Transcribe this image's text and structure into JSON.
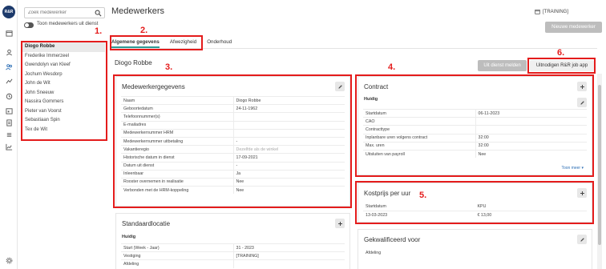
{
  "brand": {
    "logo_text": "R&R"
  },
  "rail_icons": [
    "calendar-icon",
    "user-icon",
    "team-icon",
    "trend-icon",
    "clock-icon",
    "schedule-icon",
    "report-icon",
    "list-icon",
    "chart-icon",
    "settings-icon"
  ],
  "search": {
    "placeholder": "Zoek medewerker"
  },
  "toggle": {
    "label": "Toon medewerkers uit dienst"
  },
  "employees": [
    "Diogo Robbe",
    "Frederike Immerzeel",
    "Gwendolyn van Kleef",
    "Jochum Wesdorp",
    "John de Wit",
    "John Sneeuw",
    "Nassira Gommers",
    "Pieter van Voorst",
    "Sebastiaan Spin",
    "Tex de Wit"
  ],
  "page": {
    "title": "Medewerkers",
    "training": "[TRAINING]",
    "new_button": "Nieuwe medewerker"
  },
  "tabs": [
    "Algemene gegevens",
    "Afwezigheid",
    "Onderhoud"
  ],
  "employee_name": "Diogo Robbe",
  "actions": {
    "out_of_service": "Uit dienst melden",
    "invite_app": "Uitnodigen R&R job app"
  },
  "details": {
    "title": "Medewerkergegevens",
    "rows": [
      {
        "k": "Naam",
        "v": "Diogo Robbe"
      },
      {
        "k": "Geboortedatum",
        "v": "24-11-1962"
      },
      {
        "k": "Telefoonnummer(s)",
        "v": ""
      },
      {
        "k": "E-mailadres",
        "v": ""
      },
      {
        "k": "Medewerkernummer HRM",
        "v": ""
      },
      {
        "k": "Medewerkernummer uitbetaling",
        "v": "-"
      },
      {
        "k": "Vakantieregio",
        "v": "Dezelfde als de winkel"
      },
      {
        "k": "Historische datum in dienst",
        "v": "17-09-2021"
      },
      {
        "k": "Datum uit dienst",
        "v": "-"
      },
      {
        "k": "Inleenbaar",
        "v": "Ja"
      },
      {
        "k": "Rooster overnemen in realisatie",
        "v": "Nee"
      },
      {
        "k": "Verbonden met de HRM-koppeling",
        "v": "Nee"
      }
    ]
  },
  "contract": {
    "title": "Contract",
    "current_label": "Huidig",
    "rows": [
      {
        "k": "Startdatum",
        "v": "06-11-2023"
      },
      {
        "k": "CAO",
        "v": ""
      },
      {
        "k": "Contracttype",
        "v": ""
      },
      {
        "k": "Inplanbare uren volgens contract",
        "v": "32:00"
      },
      {
        "k": "Max. uren",
        "v": "32:00"
      },
      {
        "k": "Uitsluiten van payroll",
        "v": "Nee"
      }
    ],
    "more_link": "Toon meer ▾"
  },
  "cost": {
    "title": "Kostprijs per uur",
    "headers": [
      "Startdatum",
      "KPU"
    ],
    "row": [
      "13-03-2023",
      "€ 13,00"
    ]
  },
  "standard_location": {
    "title": "Standaardlocatie",
    "current_label": "Huidig",
    "rows": [
      {
        "k": "Start (Week - Jaar)",
        "v": "31 - 2023"
      },
      {
        "k": "Vestiging",
        "v": "[TRAINING]"
      },
      {
        "k": "Afdeling",
        "v": ""
      }
    ]
  },
  "qualified": {
    "title": "Gekwalificeerd voor",
    "rows": [
      {
        "k": "Afdeling",
        "v": ""
      }
    ]
  },
  "annotations": [
    "1.",
    "2.",
    "3.",
    "4.",
    "5.",
    "6."
  ],
  "colors": {
    "accent": "#2d9a95",
    "annotation": "#e41c1c",
    "logo": "#1d3a6b"
  }
}
